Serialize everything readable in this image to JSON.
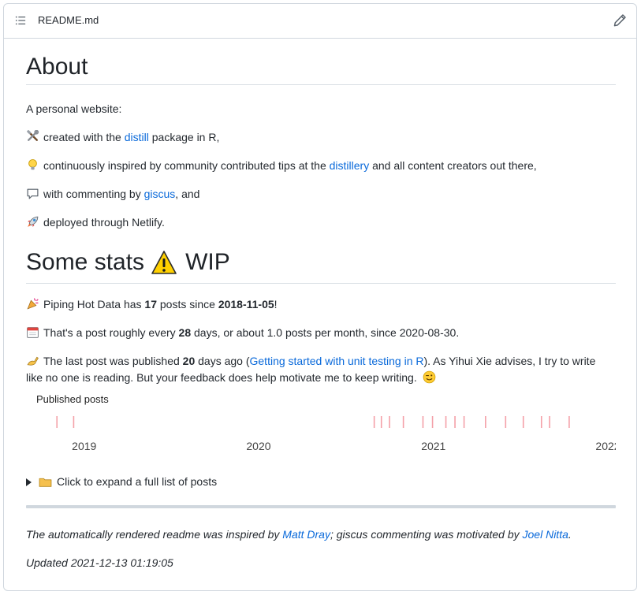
{
  "header": {
    "filename": "README.md"
  },
  "about": {
    "title": "About",
    "intro": "A personal website:",
    "items": [
      {
        "pre": "created with the ",
        "link": "distill",
        "post": " package in R,"
      },
      {
        "pre": "continuously inspired by community contributed tips at the ",
        "link": "distillery",
        "post": " and all content creators out there,"
      },
      {
        "pre": "with commenting by ",
        "link": "giscus",
        "post": ", and"
      },
      {
        "pre": "deployed through Netlify.",
        "link": "",
        "post": ""
      }
    ]
  },
  "stats": {
    "title_a": "Some stats",
    "title_b": "WIP",
    "line1": {
      "a": "Piping Hot Data has ",
      "count": "17",
      "b": " posts since ",
      "date": "2018-11-05",
      "c": "!"
    },
    "line2": {
      "a": "That's a post roughly every ",
      "days": "28",
      "b": " days, or about 1.0 posts per month, since 2020-08-30."
    },
    "line3": {
      "a": "The last post was published ",
      "days": "20",
      "b": " days ago (",
      "link": "Getting started with unit testing in R",
      "c": "). As Yihui Xie advises, I try to write",
      "d": "like no one is reading. But your feedback does help motivate me to keep writing."
    }
  },
  "chart_data": {
    "type": "scatter",
    "title": "Published posts",
    "xlabel": "",
    "ylabel": "",
    "x_ticks": [
      "2019",
      "2020",
      "2021",
      "2022"
    ],
    "xlim": [
      "2018-10-01",
      "2022-01-01"
    ],
    "mark": "tick",
    "color": "#f4a0a8",
    "x": [
      "2018-11-05",
      "2018-12-10",
      "2020-08-30",
      "2020-09-14",
      "2020-10-01",
      "2020-10-30",
      "2020-12-10",
      "2020-12-30",
      "2021-01-27",
      "2021-02-15",
      "2021-03-06",
      "2021-04-20",
      "2021-06-01",
      "2021-07-08",
      "2021-08-15",
      "2021-09-01",
      "2021-10-12"
    ]
  },
  "details": {
    "summary": "Click to expand a full list of posts"
  },
  "footer": {
    "a": "The automatically rendered readme was inspired by ",
    "link1": "Matt Dray",
    "b": "; giscus commenting was motivated by ",
    "link2": "Joel Nitta",
    "c": ".",
    "updated": "Updated 2021-12-13 01:19:05"
  },
  "colors": {
    "link": "#0969da",
    "text": "#24292f",
    "border": "#d0d7de"
  }
}
